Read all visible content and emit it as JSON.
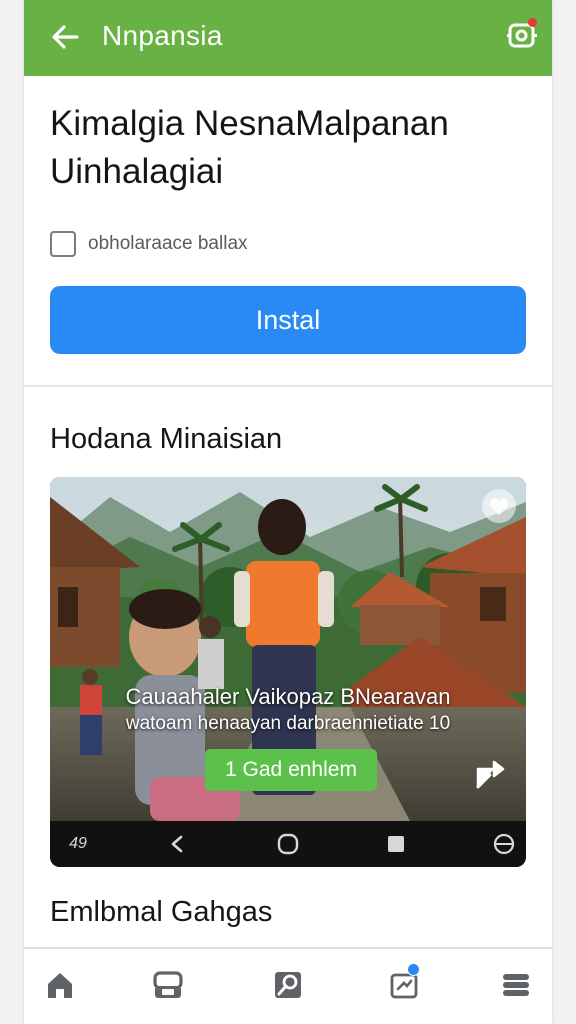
{
  "app_bar": {
    "title": "Nnpansia",
    "back_icon": "arrow-left-icon",
    "action_icon": "settings-icon",
    "background": "#68b144",
    "notification_color": "#e53935"
  },
  "headline": {
    "line1": "Kimalgia NesnaMalpanan",
    "line2": "Uinhalagiai"
  },
  "checkbox": {
    "label": "obholaraace ballax",
    "checked": false
  },
  "install_button": {
    "label": "Instal",
    "color": "#2a8af5"
  },
  "section1": {
    "title": "Hodana Minaisian"
  },
  "media": {
    "caption_line1": "Cauaahaler Vaikopaz BNearavan",
    "caption_line2": "watoam henaayan darbraennietiate 10",
    "cta_label": "1 Gad enhlem",
    "cta_color": "#5cc14a",
    "share_icon": "share-icon",
    "corner_icon": "heart-icon",
    "controls": {
      "time": "49",
      "prev_icon": "chevron-left-icon",
      "play_icon": "circle-icon",
      "stop_icon": "square-icon",
      "fullscreen_icon": "globe-icon"
    }
  },
  "section2": {
    "title": "Emlbmal Gahgas"
  },
  "bottom_nav": {
    "items": [
      {
        "icon": "home-icon"
      },
      {
        "icon": "store-icon"
      },
      {
        "icon": "search-icon"
      },
      {
        "icon": "updates-icon",
        "badge": true
      },
      {
        "icon": "menu-icon"
      }
    ],
    "badge_color": "#2a8af5"
  }
}
